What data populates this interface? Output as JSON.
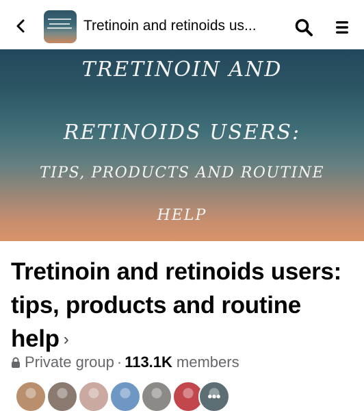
{
  "header": {
    "title": "Tretinoin and retinoids us...",
    "icons": {
      "back": "back-chevron-icon",
      "search": "search-icon",
      "menu": "menu-icon"
    }
  },
  "cover": {
    "lines": [
      "TRETINOIN AND",
      "RETINOIDS USERS:",
      "TIPS, PRODUCTS AND ROUTINE",
      "HELP"
    ],
    "colors": {
      "top": "#23475b",
      "middle": "#3f6e78",
      "bottom": "#d99268",
      "text": "#f4f4f4"
    }
  },
  "group": {
    "title": "Tretinoin and retinoids users: tips, products and routine help",
    "chevron": "›",
    "privacy": "Private group",
    "separator": "·",
    "member_count": "113.1K",
    "members_label": "members"
  },
  "avatars": {
    "count": 7,
    "colors": [
      "#b98f6e",
      "#8a7a70",
      "#c9a9a0",
      "#6f97c4",
      "#8c8a86",
      "#c2474d",
      "#5c6e74"
    ],
    "more_label": "•••"
  },
  "colors": {
    "secondary_text": "#65676b",
    "primary_text": "#050505",
    "background": "#ffffff"
  }
}
